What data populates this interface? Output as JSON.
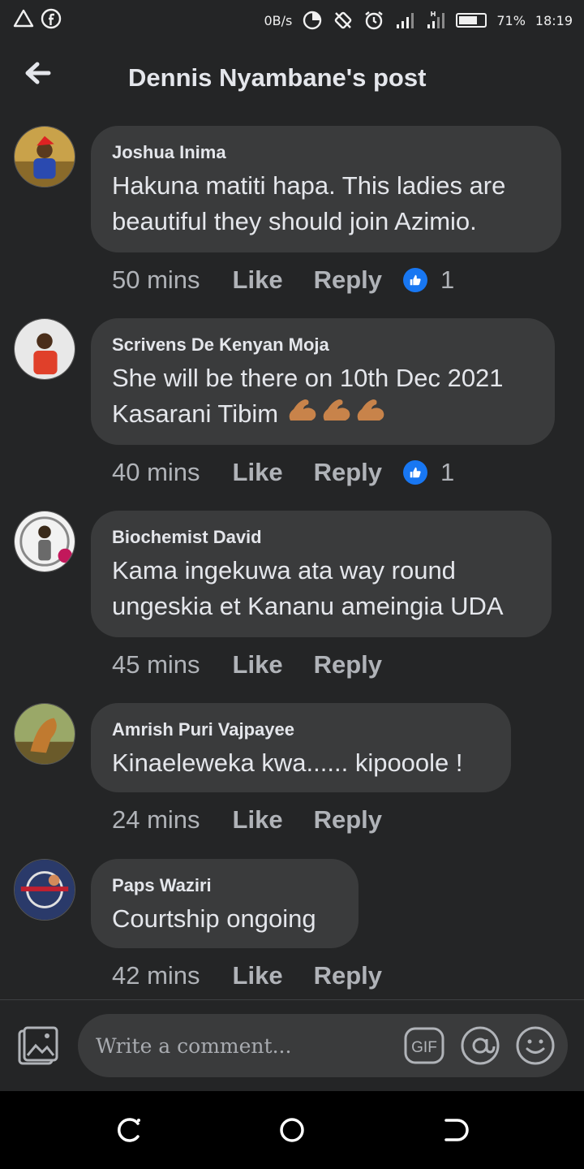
{
  "status_bar": {
    "net_speed": "0B/s",
    "battery": "71%",
    "battery_level": 0.71,
    "time": "18:19"
  },
  "header": {
    "title": "Dennis Nyambane's post"
  },
  "comments": [
    {
      "author": "Joshua Inima",
      "lines": [
        "Hakuna matiti hapa. This ladies are",
        "beautiful they should join Azimio."
      ],
      "time": "50 mins",
      "like": "Like",
      "reply": "Reply",
      "reactions": "1"
    },
    {
      "author": "Scrivens De Kenyan Moja",
      "lines": [
        "She will be there on 10th Dec 2021",
        "Kasarani Tibim"
      ],
      "time": "40 mins",
      "like": "Like",
      "reply": "Reply",
      "reactions": "1"
    },
    {
      "author": "Biochemist David",
      "lines": [
        "Kama ingekuwa ata way round",
        "ungeskia et Kananu ameingia UDA"
      ],
      "time": "45 mins",
      "like": "Like",
      "reply": "Reply"
    },
    {
      "author": "Amrish Puri Vajpayee",
      "lines": [
        "Kinaeleweka kwa...... kipooole !"
      ],
      "time": "24 mins",
      "like": "Like",
      "reply": "Reply"
    },
    {
      "author": "Paps Waziri",
      "lines": [
        "Courtship ongoing"
      ],
      "time": "42 mins",
      "like": "Like",
      "reply": "Reply"
    }
  ],
  "composer": {
    "placeholder": "Write a comment...",
    "gif_label": "GIF"
  },
  "colors": {
    "background": "#242526",
    "bubble": "#3a3b3c",
    "like_badge": "#1877f2"
  }
}
